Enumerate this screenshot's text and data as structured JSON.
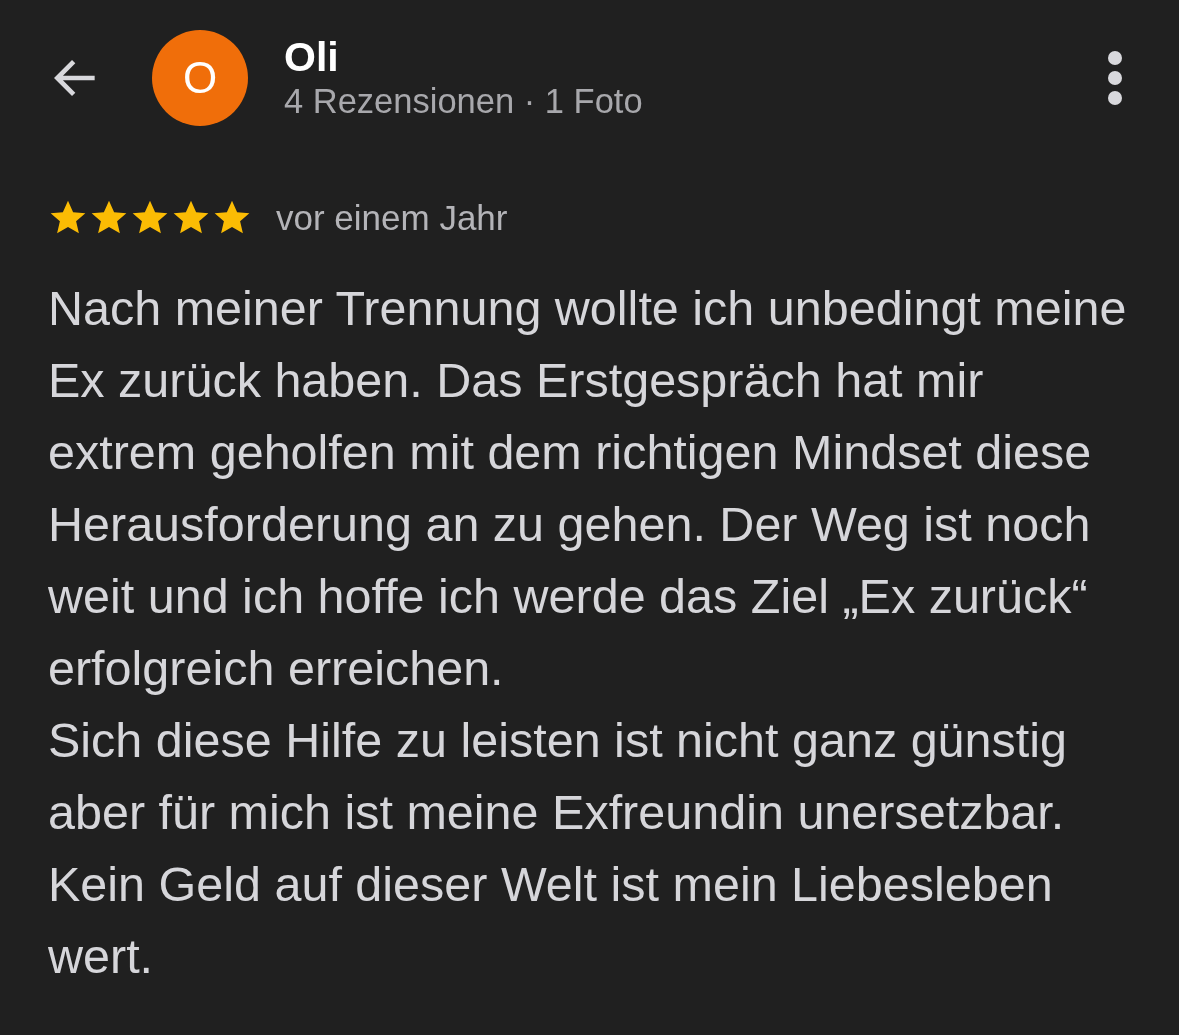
{
  "header": {
    "avatar_letter": "O",
    "name": "Oli",
    "subtitle": "4 Rezensionen · 1 Foto"
  },
  "review": {
    "stars": 5,
    "time": "vor einem Jahr",
    "text": "Nach meiner Trennung wollte ich unbedingt meine Ex zurück haben. Das Erstgespräch hat mir extrem geholfen mit dem richtigen Mindset diese Herausforderung an zu gehen. Der Weg ist noch weit und ich hoffe ich werde das Ziel „Ex zurück“ erfolgreich erreichen.\nSich diese Hilfe zu leisten ist nicht ganz günstig aber für mich ist meine Exfreundin unersetzbar. Kein Geld auf dieser Welt ist mein Liebesleben wert."
  }
}
